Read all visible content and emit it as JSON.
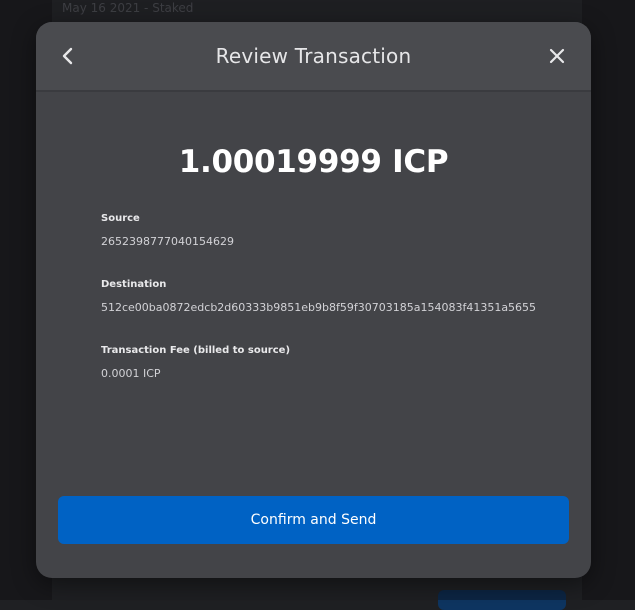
{
  "background": {
    "entry_text": "May 16 2021 - Staked"
  },
  "modal": {
    "title": "Review Transaction",
    "amount": "1.00019999 ICP",
    "fields": [
      {
        "label": "Source",
        "value": "2652398777040154629"
      },
      {
        "label": "Destination",
        "value": "512ce00ba0872edcb2d60333b9851eb9b8f59f30703185a154083f41351a5655"
      },
      {
        "label": "Transaction Fee (billed to source)",
        "value": "0.0001 ICP"
      }
    ],
    "confirm_label": "Confirm and Send"
  },
  "icons": {
    "back": "chevron-left-icon",
    "close": "close-icon"
  },
  "colors": {
    "modal_bg": "#434448",
    "header_bg": "#4a4b4f",
    "primary_button": "#0062c4",
    "page_bg": "#1f2023"
  }
}
